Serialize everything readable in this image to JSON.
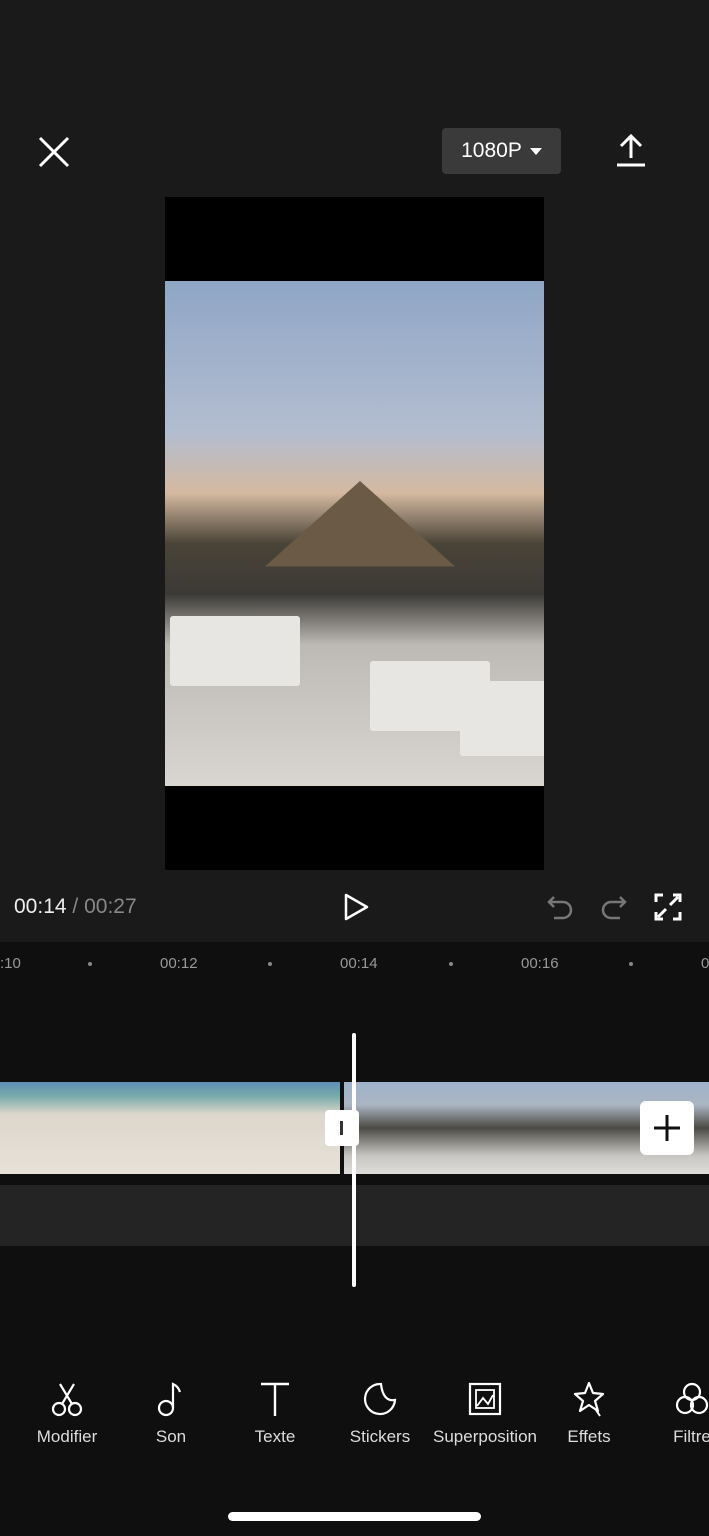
{
  "header": {
    "resolution": "1080P",
    "close_icon": "close-icon",
    "export_icon": "upload-icon"
  },
  "player": {
    "current_time": "00:14",
    "separator": "/",
    "total_time": "00:27"
  },
  "ruler": {
    "ticks": [
      ":10",
      "00:12",
      "00:14",
      "00:16",
      "0"
    ]
  },
  "toolbar": {
    "items": [
      {
        "label": "Modifier",
        "icon": "scissors-icon"
      },
      {
        "label": "Son",
        "icon": "music-note-icon"
      },
      {
        "label": "Texte",
        "icon": "text-icon"
      },
      {
        "label": "Stickers",
        "icon": "sticker-icon"
      },
      {
        "label": "Superposition",
        "icon": "overlay-icon"
      },
      {
        "label": "Effets",
        "icon": "star-effects-icon"
      },
      {
        "label": "Filtre",
        "icon": "filter-icon"
      }
    ]
  }
}
